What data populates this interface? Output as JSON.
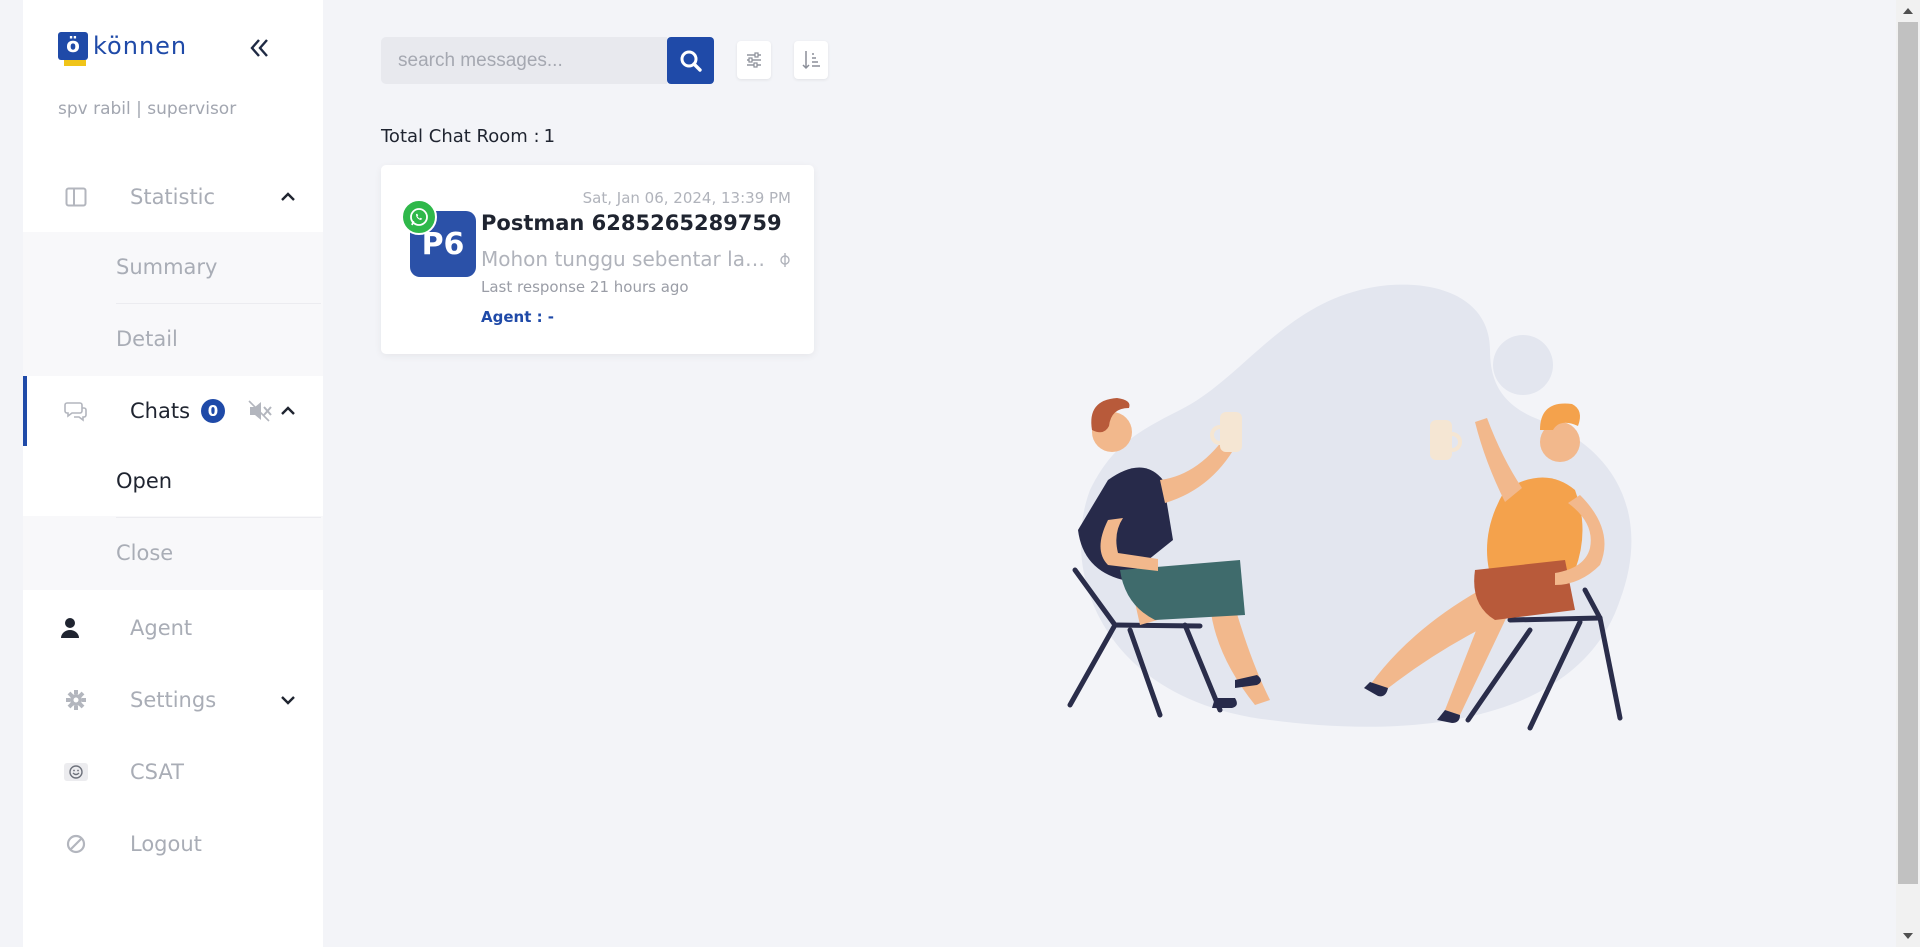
{
  "brand": {
    "logo_letter": "ö",
    "name": "können"
  },
  "user": {
    "line": "spv rabil | supervisor"
  },
  "nav": {
    "statistic": {
      "label": "Statistic",
      "icon": "columns-icon"
    },
    "summary": {
      "label": "Summary"
    },
    "detail": {
      "label": "Detail"
    },
    "chats": {
      "label": "Chats",
      "badge": "0",
      "icon": "chat-bubbles-icon"
    },
    "open": {
      "label": "Open"
    },
    "close": {
      "label": "Close"
    },
    "agent": {
      "label": "Agent",
      "icon": "user-icon"
    },
    "settings": {
      "label": "Settings",
      "icon": "gear-icon"
    },
    "csat": {
      "label": "CSAT",
      "icon": "smiley-icon"
    },
    "logout": {
      "label": "Logout",
      "icon": "ban-icon"
    }
  },
  "search": {
    "placeholder": "search messages..."
  },
  "total": {
    "label": "Total Chat Room :",
    "count": "1"
  },
  "chat_card": {
    "time": "Sat, Jan 06, 2024, 13:39 PM",
    "avatar": "P6",
    "name": "Postman 6285265289759",
    "message": "Mohon tunggu sebentar lagi...",
    "last_response": "Last response 21 hours ago",
    "agent": "Agent : -"
  },
  "colors": {
    "primary": "#1f4aa8",
    "whatsapp": "#2fb84a",
    "background": "#f3f4f8"
  }
}
